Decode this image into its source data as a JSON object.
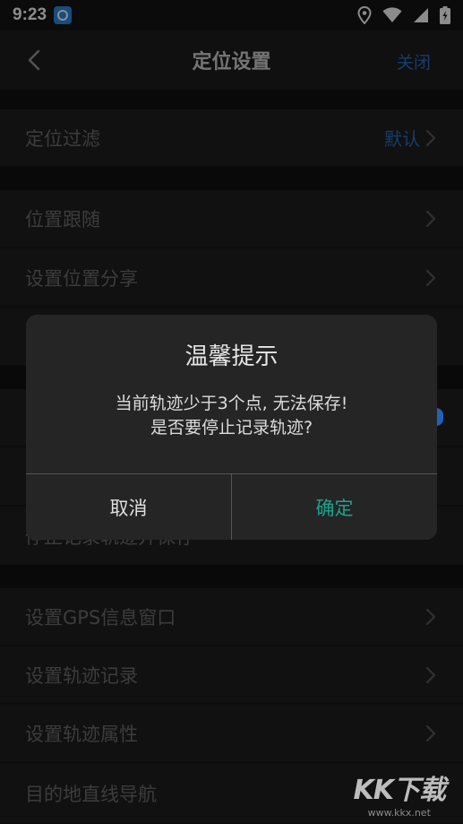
{
  "status_bar": {
    "time": "9:23",
    "icons": [
      "app-icon",
      "location-icon",
      "wifi-icon",
      "signal-icon",
      "battery-icon"
    ]
  },
  "header": {
    "title": "定位设置",
    "close_label": "关闭"
  },
  "rows": [
    {
      "label": "定位过滤",
      "value": "默认"
    },
    {
      "label": "位置跟随"
    },
    {
      "label": "设置位置分享"
    },
    {
      "label": "停止记录轨迹并保存"
    },
    {
      "label": "设置GPS信息窗口"
    },
    {
      "label": "设置轨迹记录"
    },
    {
      "label": "设置轨迹属性"
    },
    {
      "label": "目的地直线导航"
    }
  ],
  "dialog": {
    "title": "温馨提示",
    "message_line1": "当前轨迹少于3个点, 无法保存!",
    "message_line2": "是否要停止记录轨迹?",
    "cancel_label": "取消",
    "confirm_label": "确定"
  },
  "watermark": {
    "logo": "KK下载",
    "url": "www.kkx.net"
  },
  "colors": {
    "accent_blue": "#2a6fc2",
    "confirm_green": "#1aa38a",
    "background": "#1b1b1b"
  }
}
